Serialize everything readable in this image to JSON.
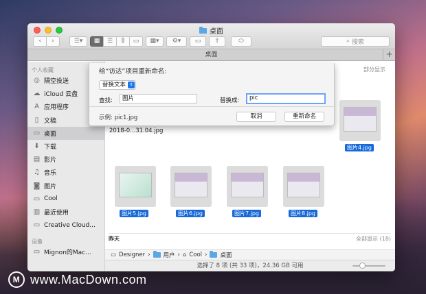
{
  "window": {
    "title": "桌面"
  },
  "toolbar": {
    "back_icon": "chevron-left-icon",
    "forward_icon": "chevron-right-icon",
    "search_placeholder": "搜索"
  },
  "tabbar": {
    "title": "桌面",
    "add_label": "+"
  },
  "sidebar": {
    "favorites_header": "个人收藏",
    "items": [
      {
        "label": "隔空投送",
        "icon": "airdrop-icon"
      },
      {
        "label": "iCloud 云盘",
        "icon": "cloud-icon"
      },
      {
        "label": "应用程序",
        "icon": "applications-icon"
      },
      {
        "label": "文稿",
        "icon": "document-icon"
      },
      {
        "label": "桌面",
        "icon": "desktop-icon",
        "selected": true
      },
      {
        "label": "下载",
        "icon": "download-icon"
      },
      {
        "label": "影片",
        "icon": "film-icon"
      },
      {
        "label": "音乐",
        "icon": "music-icon"
      },
      {
        "label": "图片",
        "icon": "camera-icon"
      },
      {
        "label": "Cool",
        "icon": "folder-icon"
      },
      {
        "label": "最近使用",
        "icon": "recent-icon"
      },
      {
        "label": "Creative Cloud...",
        "icon": "folder-icon"
      }
    ],
    "devices_header": "设备",
    "devices": [
      {
        "label": "Mignon的Mac...",
        "icon": "laptop-icon"
      }
    ]
  },
  "main": {
    "partial_show": "部分显示",
    "files": [
      {
        "name": "2018-0...31.04.jpg"
      },
      {
        "name": "图片4.jpg"
      },
      {
        "name": "图片5.jpg"
      },
      {
        "name": "图片6.jpg"
      },
      {
        "name": "图片7.jpg"
      },
      {
        "name": "图片8.jpg"
      }
    ],
    "yesterday_header": "昨天",
    "show_all": "全部显示 (18)"
  },
  "pathbar": {
    "items": [
      "Designer",
      "用户",
      "Cool",
      "桌面"
    ]
  },
  "statusbar": {
    "text": "选择了 8 项 (共 33 项)，24.36 GB 可用"
  },
  "rename_sheet": {
    "title": "给“访达”项目重新命名:",
    "mode": "替换文本",
    "find_label": "查找:",
    "find_value": "图片",
    "replace_label": "替换成:",
    "replace_value": "pic",
    "example": "示例: pic1.jpg",
    "cancel_label": "取消",
    "rename_label": "重新命名"
  },
  "watermark": {
    "logo": "M",
    "text": "www.MacDown.com"
  },
  "colors": {
    "selection": "#1669d8",
    "focus_ring": "#6da3f5",
    "accent": "#1b77f0"
  }
}
